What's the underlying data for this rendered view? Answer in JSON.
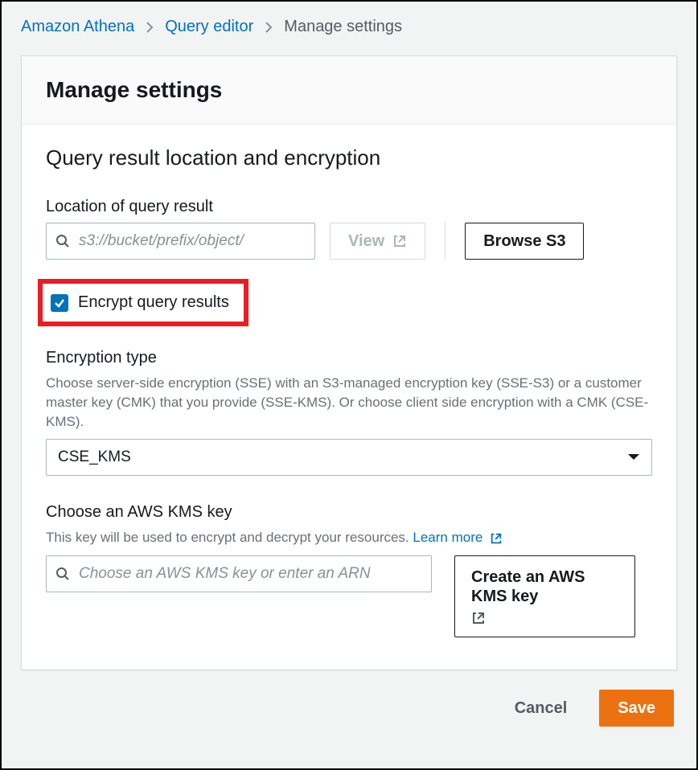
{
  "breadcrumb": {
    "root": "Amazon Athena",
    "mid": "Query editor",
    "current": "Manage settings"
  },
  "header": {
    "title": "Manage settings"
  },
  "section": {
    "title": "Query result location and encryption"
  },
  "location": {
    "label": "Location of query result",
    "placeholder": "s3://bucket/prefix/object/",
    "view_label": "View",
    "browse_label": "Browse S3"
  },
  "encrypt_checkbox": {
    "label": "Encrypt query results",
    "checked": true
  },
  "encryption_type": {
    "label": "Encryption type",
    "help": "Choose server-side encryption (SSE) with an S3-managed encryption key (SSE-S3) or a customer master key (CMK) that you provide (SSE-KMS). Or choose client side encryption with a CMK (CSE-KMS).",
    "selected": "CSE_KMS"
  },
  "kms": {
    "label": "Choose an AWS KMS key",
    "help_prefix": "This key will be used to encrypt and decrypt your resources. ",
    "learn_more": "Learn more",
    "placeholder": "Choose an AWS KMS key or enter an ARN",
    "create_label": "Create an AWS KMS key"
  },
  "footer": {
    "cancel": "Cancel",
    "save": "Save"
  }
}
